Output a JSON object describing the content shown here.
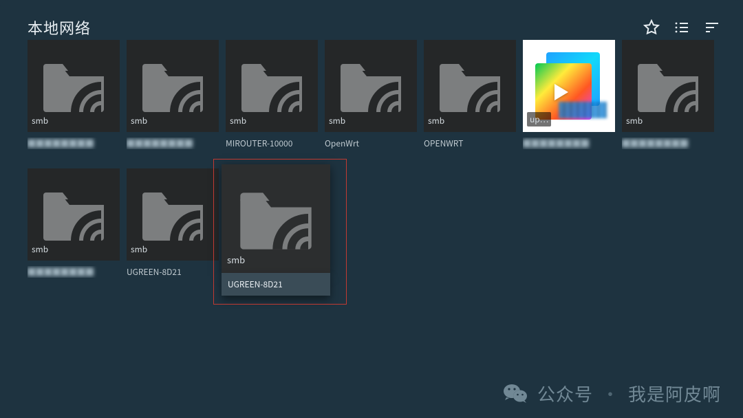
{
  "header": {
    "title": "本地网络"
  },
  "actions": {
    "star": "star-icon",
    "list": "list-icon",
    "sort": "sort-icon"
  },
  "tiles": [
    {
      "proto": "smb",
      "label": "████",
      "blur": true
    },
    {
      "proto": "smb",
      "label": "████",
      "blur": true
    },
    {
      "proto": "smb",
      "label": "MIROUTER-10000"
    },
    {
      "proto": "smb",
      "label": "OpenWrt"
    },
    {
      "proto": "smb",
      "label": "OPENWRT"
    },
    {
      "proto": "upnp",
      "label": "████",
      "blur": true,
      "upnp": true,
      "badge": "up…"
    },
    {
      "proto": "smb",
      "label": "████",
      "blur": true
    },
    {
      "proto": "smb",
      "label": "████",
      "blur": true
    },
    {
      "proto": "smb",
      "label": "UGREEN-8D21"
    },
    {
      "proto": "smb",
      "label": "UGREEN-8D21",
      "focus": true
    }
  ],
  "watermark": {
    "prefix": "公众号",
    "name": "我是阿皮啊"
  }
}
